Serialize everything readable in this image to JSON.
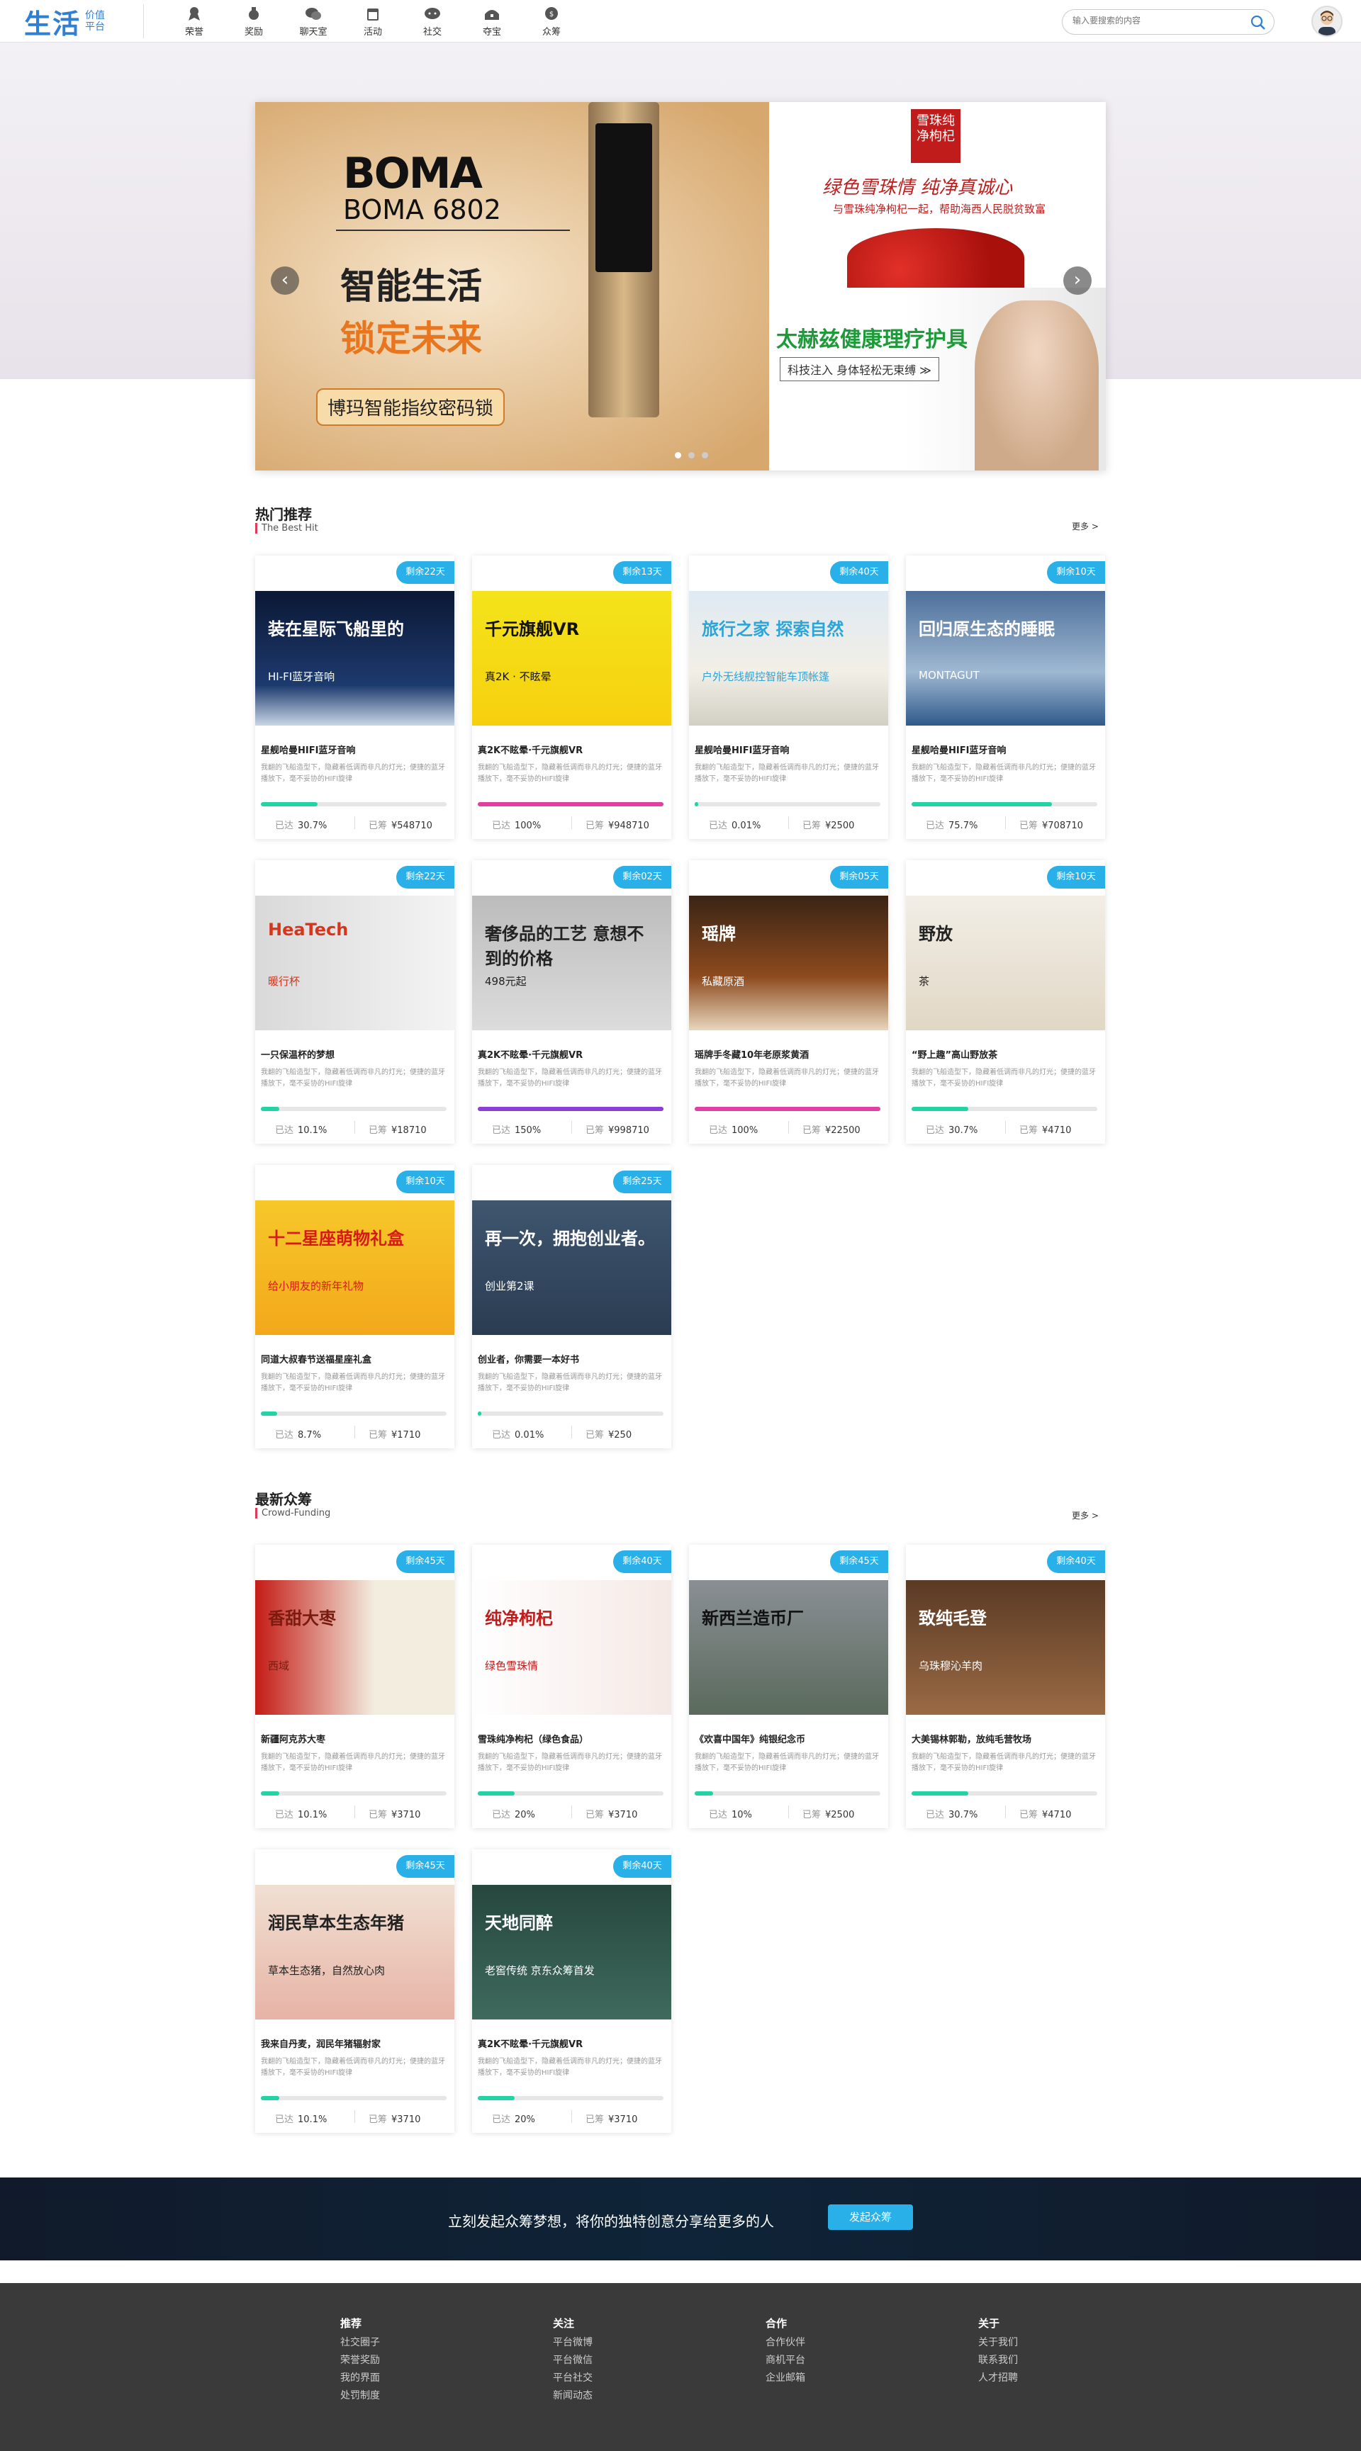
{
  "header": {
    "logo_main": "生活",
    "logo_sub": "价值平台",
    "nav": [
      {
        "label": "荣誉",
        "icon": "medal-icon"
      },
      {
        "label": "奖励",
        "icon": "award-icon"
      },
      {
        "label": "聊天室",
        "icon": "chat-icon"
      },
      {
        "label": "活动",
        "icon": "calendar-icon"
      },
      {
        "label": "社交",
        "icon": "social-icon"
      },
      {
        "label": "夺宝",
        "icon": "treasure-icon"
      },
      {
        "label": "众筹",
        "icon": "crowdfunding-icon"
      }
    ],
    "search_placeholder": "输入要搜索的内容"
  },
  "banner": {
    "brand": "BOMA",
    "model": "BOMA 6802",
    "headline1": "智能生活",
    "headline2": "锁定未来",
    "tagline": "博玛智能指纹密码锁",
    "gouqi_badge": "雪珠纯净枸杞",
    "gouqi_title": "绿色雪珠情 纯净真诚心",
    "gouqi_sub": "与雪珠纯净枸杞一起，帮助海西人民脱贫致富",
    "taihe_title": "太赫兹健康理疗护具",
    "taihe_sub": "科技注入 身体轻松无束缚 ≫"
  },
  "sections": {
    "hot": {
      "title": "热门推荐",
      "subtitle": "The Best Hit",
      "more": "更多 >"
    },
    "crowd": {
      "title": "最新众筹",
      "subtitle": "Crowd-Funding",
      "more": "更多 >"
    }
  },
  "labels": {
    "progress": "已达",
    "raised": "已筹"
  },
  "hot_cards": [
    {
      "badge": "剩余22天",
      "title": "星舰哈曼HIFI蓝牙音响",
      "desc": "我翻的飞船造型下，隐藏着低调而非凡的灯光；便捷的蓝牙播放下，毫不妥协的HIFI旋律",
      "progress": "30.7%",
      "raised": "¥548710",
      "fill": 0.307,
      "color": "#22d3a5",
      "img_title": "装在星际飞船里的",
      "img_sub": "HI-FI蓝牙音响"
    },
    {
      "badge": "剩余13天",
      "title": "真2K不眩晕·千元旗舰VR",
      "desc": "我翻的飞船造型下，隐藏着低调而非凡的灯光；便捷的蓝牙播放下，毫不妥协的HIFI旋律",
      "progress": "100%",
      "raised": "¥948710",
      "fill": 1.0,
      "color": "#e23fa5",
      "img_title": "千元旗舰VR",
      "img_sub": "真2K · 不眩晕"
    },
    {
      "badge": "剩余40天",
      "title": "星舰哈曼HIFI蓝牙音响",
      "desc": "我翻的飞船造型下，隐藏着低调而非凡的灯光；便捷的蓝牙播放下，毫不妥协的HIFI旋律",
      "progress": "0.01%",
      "raised": "¥2500",
      "fill": 0.0001,
      "color": "#22d3a5",
      "img_title": "旅行之家 探索自然",
      "img_sub": "户外无线舰控智能车顶帐篷"
    },
    {
      "badge": "剩余10天",
      "title": "星舰哈曼HIFI蓝牙音响",
      "desc": "我翻的飞船造型下，隐藏着低调而非凡的灯光；便捷的蓝牙播放下，毫不妥协的HIFI旋律",
      "progress": "75.7%",
      "raised": "¥708710",
      "fill": 0.757,
      "color": "#22d3a5",
      "img_title": "回归原生态的睡眠",
      "img_sub": "MONTAGUT"
    },
    {
      "badge": "剩余22天",
      "title": "一只保温杯的梦想",
      "desc": "我翻的飞船造型下，隐藏着低调而非凡的灯光；便捷的蓝牙播放下，毫不妥协的HIFI旋律",
      "progress": "10.1%",
      "raised": "¥18710",
      "fill": 0.101,
      "color": "#22d3a5",
      "img_title": "HeaTech",
      "img_sub": "暖行杯"
    },
    {
      "badge": "剩余02天",
      "title": "真2K不眩晕·千元旗舰VR",
      "desc": "我翻的飞船造型下，隐藏着低调而非凡的灯光；便捷的蓝牙播放下，毫不妥协的HIFI旋律",
      "progress": "150%",
      "raised": "¥998710",
      "fill": 1.0,
      "color": "#8b3fd6",
      "img_title": "奢侈品的工艺 意想不到的价格",
      "img_sub": "498元起"
    },
    {
      "badge": "剩余05天",
      "title": "瑶牌手冬藏10年老原浆黄酒",
      "desc": "我翻的飞船造型下，隐藏着低调而非凡的灯光；便捷的蓝牙播放下，毫不妥协的HIFI旋律",
      "progress": "100%",
      "raised": "¥22500",
      "fill": 1.0,
      "color": "#e23fa5",
      "img_title": "瑶牌",
      "img_sub": "私藏原酒"
    },
    {
      "badge": "剩余10天",
      "title": "“野上趣”高山野放茶",
      "desc": "我翻的飞船造型下，隐藏着低调而非凡的灯光；便捷的蓝牙播放下，毫不妥协的HIFI旋律",
      "progress": "30.7%",
      "raised": "¥4710",
      "fill": 0.307,
      "color": "#22d3a5",
      "img_title": "野放",
      "img_sub": "茶"
    },
    {
      "badge": "剩余10天",
      "title": "同道大叔春节送福星座礼盒",
      "desc": "我翻的飞船造型下，隐藏着低调而非凡的灯光；便捷的蓝牙播放下，毫不妥协的HIFI旋律",
      "progress": "8.7%",
      "raised": "¥1710",
      "fill": 0.087,
      "color": "#22d3a5",
      "img_title": "十二星座萌物礼盒",
      "img_sub": "给小朋友的新年礼物"
    },
    {
      "badge": "剩余25天",
      "title": "创业者，你需要一本好书",
      "desc": "我翻的飞船造型下，隐藏着低调而非凡的灯光；便捷的蓝牙播放下，毫不妥协的HIFI旋律",
      "progress": "0.01%",
      "raised": "¥250",
      "fill": 0.0001,
      "color": "#22d3a5",
      "img_title": "再一次，拥抱创业者。",
      "img_sub": "创业第2课"
    }
  ],
  "crowd_cards": [
    {
      "badge": "剩余45天",
      "title": "新疆阿克苏大枣",
      "desc": "我翻的飞船造型下，隐藏着低调而非凡的灯光；便捷的蓝牙播放下，毫不妥协的HIFI旋律",
      "progress": "10.1%",
      "raised": "¥3710",
      "fill": 0.101,
      "color": "#22d3a5",
      "img_title": "香甜大枣",
      "img_sub": "西域"
    },
    {
      "badge": "剩余40天",
      "title": "雪珠纯净枸杞（绿色食品）",
      "desc": "我翻的飞船造型下，隐藏着低调而非凡的灯光；便捷的蓝牙播放下，毫不妥协的HIFI旋律",
      "progress": "20%",
      "raised": "¥3710",
      "fill": 0.2,
      "color": "#22d3a5",
      "img_title": "纯净枸杞",
      "img_sub": "绿色雪珠情"
    },
    {
      "badge": "剩余45天",
      "title": "《欢喜中国年》纯银纪念币",
      "desc": "我翻的飞船造型下，隐藏着低调而非凡的灯光；便捷的蓝牙播放下，毫不妥协的HIFI旋律",
      "progress": "10%",
      "raised": "¥2500",
      "fill": 0.1,
      "color": "#22d3a5",
      "img_title": "新西兰造币厂",
      "img_sub": ""
    },
    {
      "badge": "剩余40天",
      "title": "大美锡林郭勒，放纯毛营牧场",
      "desc": "我翻的飞船造型下，隐藏着低调而非凡的灯光；便捷的蓝牙播放下，毫不妥协的HIFI旋律",
      "progress": "30.7%",
      "raised": "¥4710",
      "fill": 0.307,
      "color": "#22d3a5",
      "img_title": "致纯毛登",
      "img_sub": "乌珠穆沁羊肉"
    },
    {
      "badge": "剩余45天",
      "title": "我来自丹麦，润民年猪辐射家",
      "desc": "我翻的飞船造型下，隐藏着低调而非凡的灯光；便捷的蓝牙播放下，毫不妥协的HIFI旋律",
      "progress": "10.1%",
      "raised": "¥3710",
      "fill": 0.101,
      "color": "#22d3a5",
      "img_title": "润民草本生态年猪",
      "img_sub": "草本生态猪，自然放心肉"
    },
    {
      "badge": "剩余40天",
      "title": "真2K不眩晕·千元旗舰VR",
      "desc": "我翻的飞船造型下，隐藏着低调而非凡的灯光；便捷的蓝牙播放下，毫不妥协的HIFI旋律",
      "progress": "20%",
      "raised": "¥3710",
      "fill": 0.2,
      "color": "#22d3a5",
      "img_title": "天地同醉",
      "img_sub": "老窖传统 京东众筹首发"
    }
  ],
  "cta": {
    "text": "立刻发起众筹梦想，将你的独特创意分享给更多的人",
    "button": "发起众筹"
  },
  "footer": [
    {
      "head": "推荐",
      "items": [
        "社交圈子",
        "荣誉奖励",
        "我的界面",
        "处罚制度"
      ]
    },
    {
      "head": "关注",
      "items": [
        "平台微博",
        "平台微信",
        "平台社交",
        "新闻动态"
      ]
    },
    {
      "head": "合作",
      "items": [
        "合作伙伴",
        "商机平台",
        "企业邮箱"
      ]
    },
    {
      "head": "关于",
      "items": [
        "关于我们",
        "联系我们",
        "人才招聘"
      ]
    }
  ]
}
